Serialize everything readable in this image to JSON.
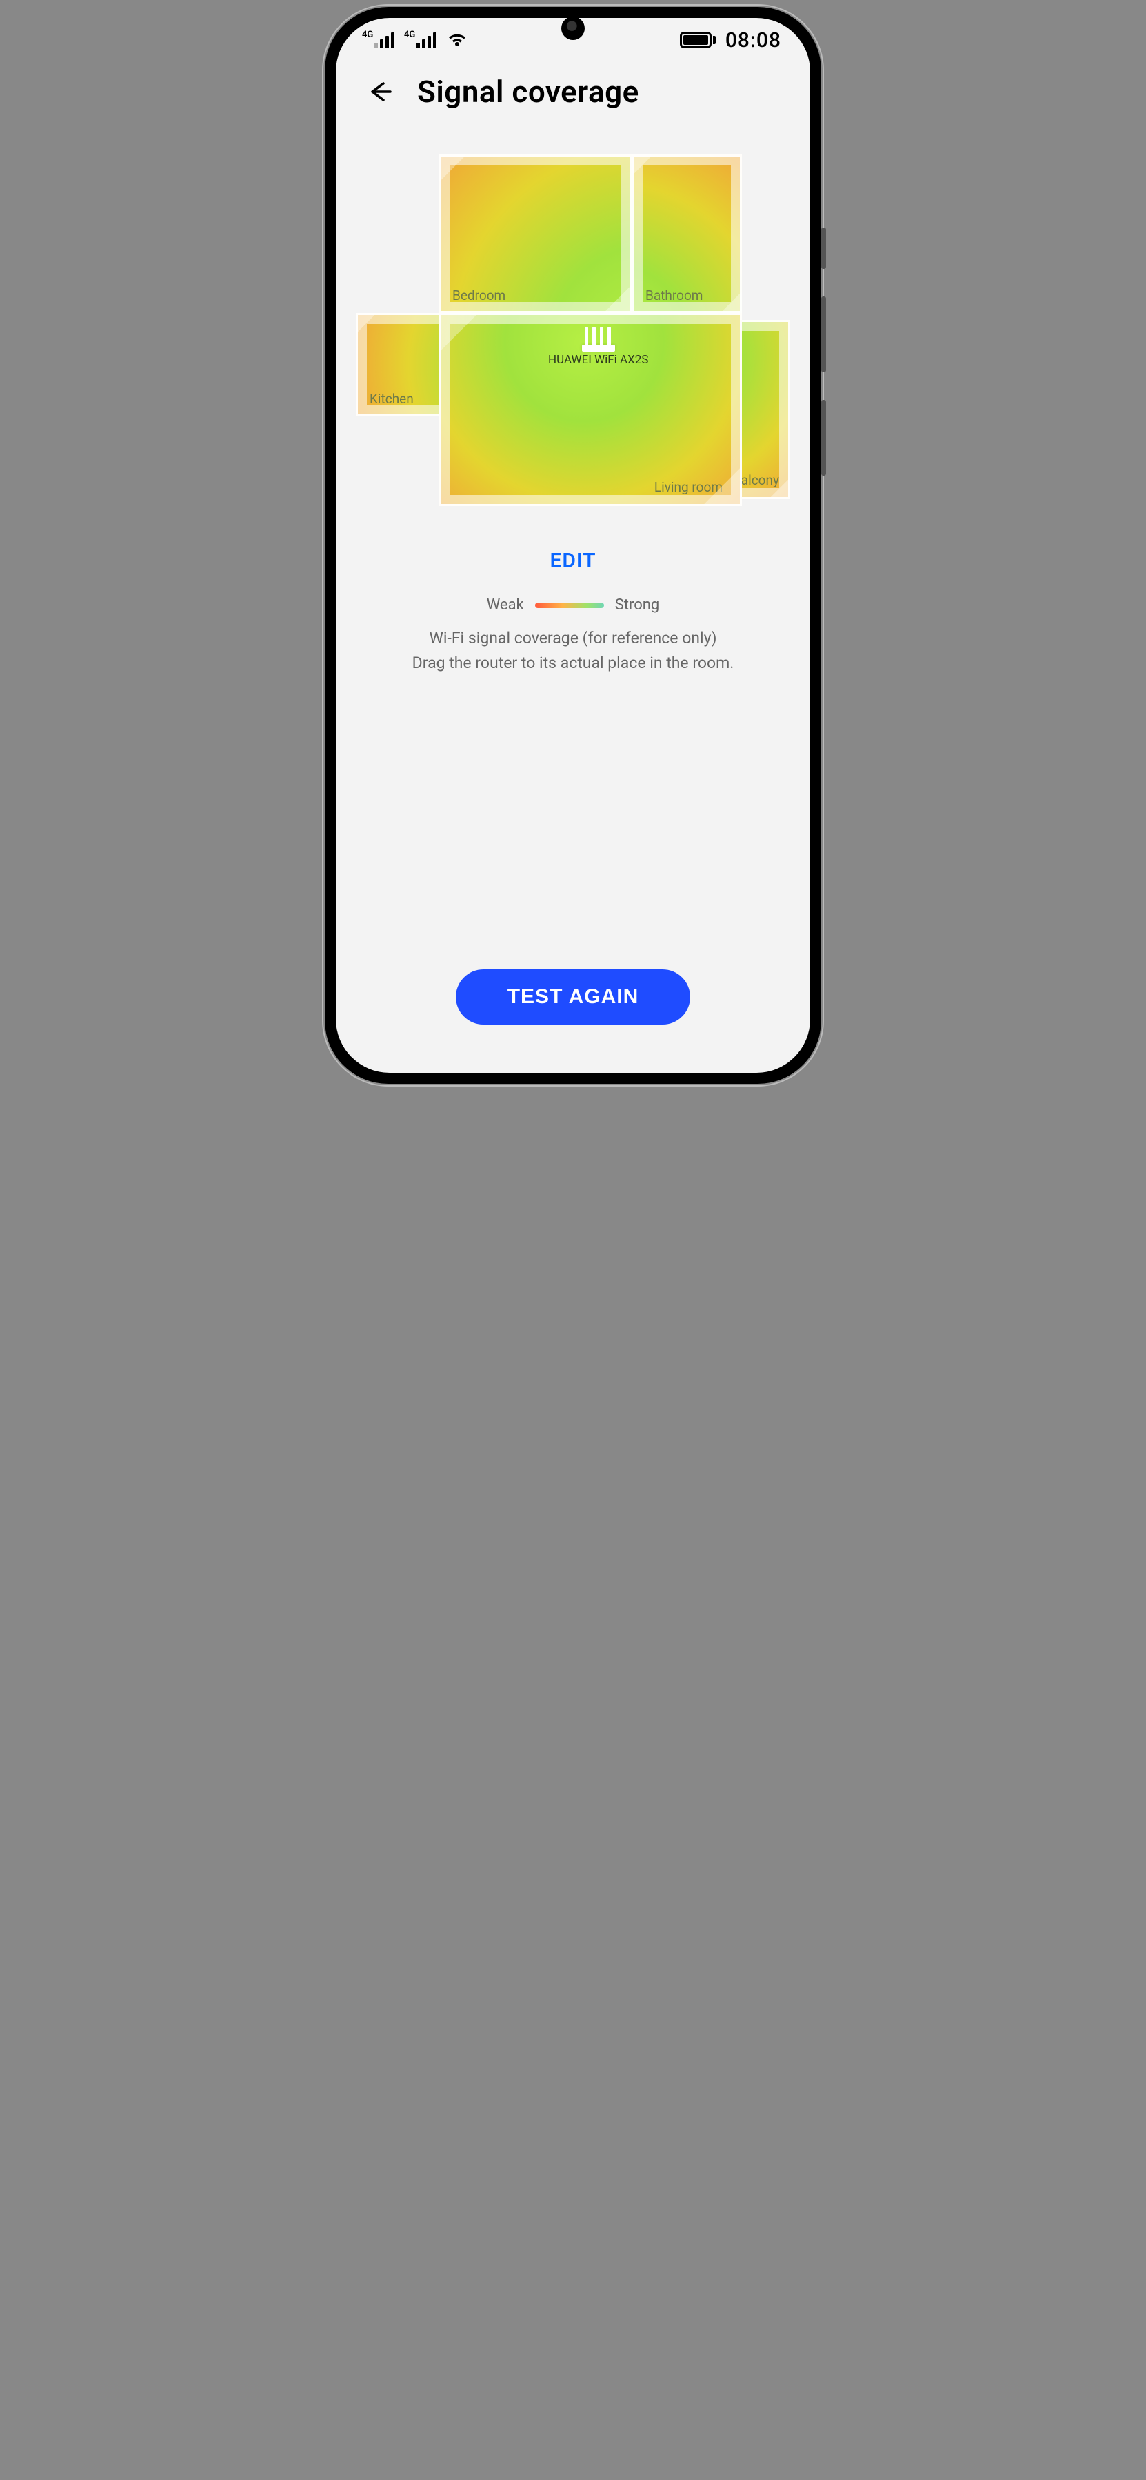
{
  "statusbar": {
    "net_label": "4G",
    "time": "08:08"
  },
  "header": {
    "title": "Signal coverage"
  },
  "plan": {
    "router_name": "HUAWEI WiFi AX2S",
    "rooms": {
      "bedroom": "Bedroom",
      "bathroom": "Bathroom",
      "kitchen": "Kitchen",
      "living": "Living room",
      "balcony": "Balcony"
    }
  },
  "edit_label": "EDIT",
  "legend": {
    "weak": "Weak",
    "strong": "Strong"
  },
  "info": {
    "line1": "Wi-Fi signal coverage (for reference only)",
    "line2": "Drag the router to its actual place in the room."
  },
  "button_label": "TEST AGAIN"
}
